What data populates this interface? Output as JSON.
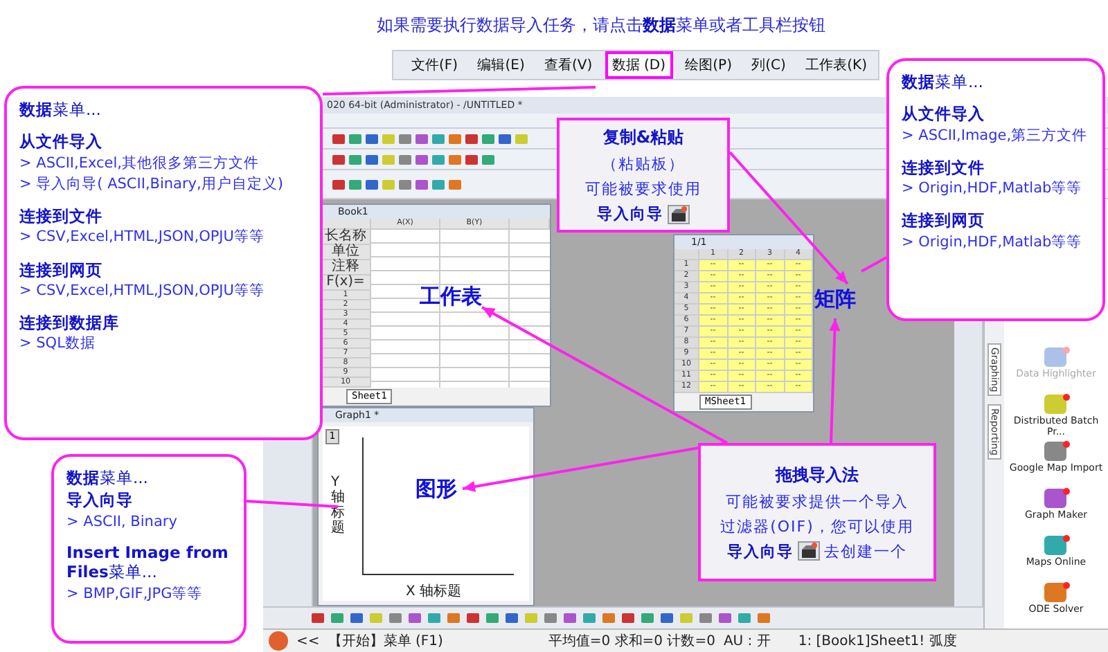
{
  "heading": "如果需要执行数据导入任务，请点击**数据**菜单或者工具栏按钮",
  "menu_bar": {
    "items": [
      {
        "label": "文件(F)",
        "selected": false
      },
      {
        "label": "编辑(E)",
        "selected": false
      },
      {
        "label": "查看(V)",
        "selected": false
      },
      {
        "label": "数据 (D)",
        "selected": true
      },
      {
        "label": "绘图(P)",
        "selected": false
      },
      {
        "label": "列(C)",
        "selected": false
      },
      {
        "label": "工作表(K)",
        "selected": false
      }
    ]
  },
  "app": {
    "title": "020 64-bit (Administrator) - /UNTITLED *",
    "worksheet": {
      "title": "Book1",
      "columns": [
        "A(X)",
        "B(Y)"
      ],
      "row_headers": [
        "长名称",
        "单位",
        "注释",
        "F(x)="
      ],
      "rows": [
        "1",
        "2",
        "3",
        "4",
        "5",
        "6",
        "7",
        "8",
        "9",
        "10"
      ],
      "sheet_tab": "Sheet1"
    },
    "matrix": {
      "title": "1/1",
      "columns": [
        "1",
        "2",
        "3",
        "4"
      ],
      "rows": [
        "1",
        "2",
        "3",
        "4",
        "5",
        "6",
        "7",
        "8",
        "9",
        "10",
        "11",
        "12"
      ],
      "cell": "--",
      "sheet_tab": "MSheet1"
    },
    "graph": {
      "title": "Graph1 *",
      "layer": "1",
      "xlabel": "X 轴标题",
      "ylabel": "Y 轴标题"
    },
    "side_tabs": [
      "Graphing",
      "Reporting"
    ],
    "apps": [
      {
        "name": "Data Highlighter",
        "disabled": true
      },
      {
        "name": "Distributed Batch Pr...",
        "disabled": false
      },
      {
        "name": "Google Map Import",
        "disabled": false
      },
      {
        "name": "Graph Maker",
        "disabled": false
      },
      {
        "name": "Maps Online",
        "disabled": false
      },
      {
        "name": "ODE Solver",
        "disabled": false
      }
    ],
    "status_bar": {
      "collapse": "<<",
      "hint": "【开始】菜单 (F1)",
      "stats": "平均值=0 求和=0 计数=0",
      "au": "AU : 开",
      "sheet": "1: [Book1]Sheet1! 弧度"
    }
  },
  "callouts": [
    {
      "kind": "bubble",
      "sections": [
        [
          {
            "kind": "intro",
            "text": "**数据**菜单..."
          }
        ],
        [
          {
            "kind": "heading",
            "text": "从文件导入"
          },
          {
            "kind": "item",
            "text": "> ASCII,Excel,其他很多第三方文件"
          },
          {
            "kind": "item",
            "text": "> 导入向导( ASCII,Binary,用户自定义)"
          }
        ],
        [
          {
            "kind": "heading",
            "text": "连接到文件"
          },
          {
            "kind": "item",
            "text": "> CSV,Excel,HTML,JSON,OPJU等等"
          }
        ],
        [
          {
            "kind": "heading",
            "text": "连接到网页"
          },
          {
            "kind": "item",
            "text": "> CSV,Excel,HTML,JSON,OPJU等等"
          }
        ],
        [
          {
            "kind": "heading",
            "text": "连接到数据库"
          },
          {
            "kind": "item",
            "text": "> SQL数据"
          }
        ]
      ]
    },
    {
      "kind": "note",
      "title": "复制&粘贴",
      "lines": [
        {
          "kind": "text",
          "text": "（粘贴板）"
        },
        {
          "kind": "text",
          "text": "可能被要求使用"
        },
        {
          "kind": "wizard",
          "text": "导入向导"
        }
      ]
    },
    {
      "kind": "bubble",
      "sections": [
        [
          {
            "kind": "intro",
            "text": "**数据**菜单..."
          }
        ],
        [
          {
            "kind": "heading",
            "text": "从文件导入"
          },
          {
            "kind": "item",
            "text": "> ASCII,Image,第三方文件"
          }
        ],
        [
          {
            "kind": "heading",
            "text": "连接到文件"
          },
          {
            "kind": "item",
            "text": "> Origin,HDF,Matlab等等"
          }
        ],
        [
          {
            "kind": "heading",
            "text": "连接到网页"
          },
          {
            "kind": "item",
            "text": "> Origin,HDF,Matlab等等"
          }
        ]
      ]
    },
    {
      "kind": "bubble",
      "sections": [
        [
          {
            "kind": "intro",
            "text": "**数据**菜单..."
          },
          {
            "kind": "heading",
            "text": "导入向导"
          },
          {
            "kind": "item",
            "text": "> ASCII, Binary"
          }
        ],
        [
          {
            "kind": "intro",
            "text": "**Insert Image from Files**菜单..."
          },
          {
            "kind": "item",
            "text": "> BMP,GIF,JPG等等"
          }
        ]
      ]
    },
    {
      "kind": "note",
      "title": "拖拽导入法",
      "lines": [
        {
          "kind": "text",
          "text": "可能被要求提供一个导入"
        },
        {
          "kind": "text",
          "text": "过滤器(OIF)，您可以使用"
        },
        {
          "kind": "wizard",
          "text": "导入向导",
          "after": "去创建一个"
        }
      ]
    }
  ],
  "labels": [
    {
      "text": "工作表"
    },
    {
      "text": "矩阵"
    },
    {
      "text": "图形"
    }
  ]
}
